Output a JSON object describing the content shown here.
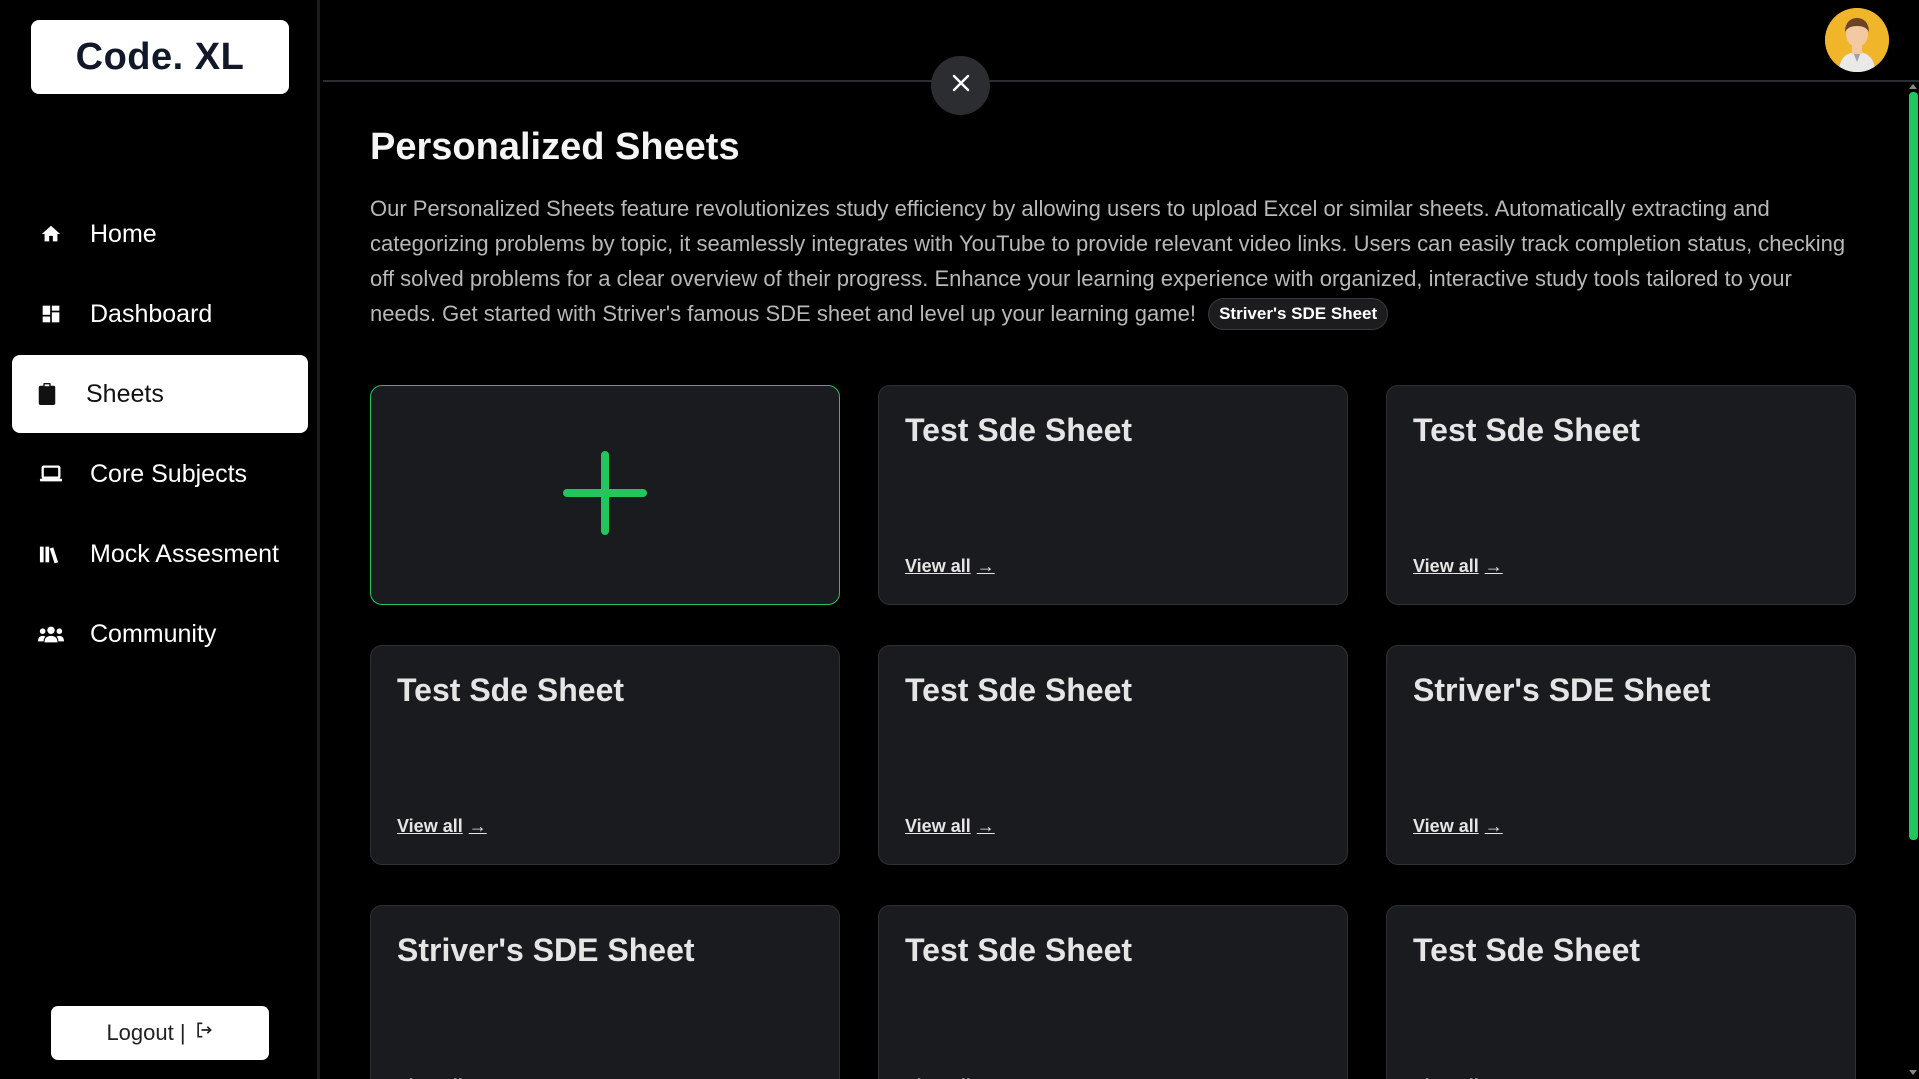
{
  "app": {
    "logo": "Code. XL"
  },
  "sidebar": {
    "items": [
      {
        "label": "Home",
        "icon": "home-icon",
        "active": false
      },
      {
        "label": "Dashboard",
        "icon": "dashboard-icon",
        "active": false
      },
      {
        "label": "Sheets",
        "icon": "clipboard-icon",
        "active": true
      },
      {
        "label": "Core Subjects",
        "icon": "laptop-icon",
        "active": false
      },
      {
        "label": "Mock Assesment",
        "icon": "books-icon",
        "active": false
      },
      {
        "label": "Community",
        "icon": "users-icon",
        "active": false
      }
    ],
    "logout_label": "Logout |"
  },
  "main": {
    "title": "Personalized Sheets",
    "description": "Our Personalized Sheets feature revolutionizes study efficiency by allowing users to upload Excel or similar sheets. Automatically extracting and categorizing problems by topic, it seamlessly integrates with YouTube to provide relevant video links. Users can easily track completion status, checking off solved problems for a clear overview of their progress. Enhance your learning experience with organized, interactive study tools tailored to your needs. Get started with Striver's famous SDE sheet and level up your learning game!",
    "badge": "Striver's SDE Sheet",
    "view_all_label": "View all",
    "cards": [
      {
        "title": "Test Sde Sheet"
      },
      {
        "title": "Test Sde Sheet"
      },
      {
        "title": "Test Sde Sheet"
      },
      {
        "title": "Test Sde Sheet"
      },
      {
        "title": "Striver's SDE Sheet"
      },
      {
        "title": "Striver's SDE Sheet"
      },
      {
        "title": "Test Sde Sheet"
      },
      {
        "title": "Test Sde Sheet"
      }
    ]
  },
  "colors": {
    "accent": "#22c55e",
    "card_bg": "#1a1b1e",
    "background": "#000000"
  }
}
